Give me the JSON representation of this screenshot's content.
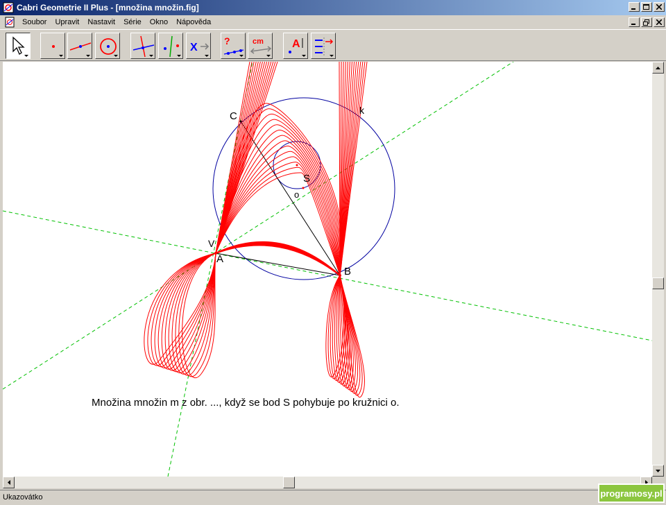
{
  "window": {
    "title": "Cabri Geometrie II Plus - [množina množin.fig]"
  },
  "menu": {
    "items": [
      {
        "label": "Soubor",
        "name": "menu-soubor"
      },
      {
        "label": "Upravit",
        "name": "menu-upravit"
      },
      {
        "label": "Nastavit",
        "name": "menu-nastavit"
      },
      {
        "label": "Série",
        "name": "menu-serie"
      },
      {
        "label": "Okno",
        "name": "menu-okno"
      },
      {
        "label": "Nápověda",
        "name": "menu-napoveda"
      }
    ]
  },
  "toolbar": {
    "tools": [
      {
        "icon": "pointer-icon",
        "name": "tool-pointer",
        "selected": true
      },
      {
        "icon": "point-icon",
        "name": "tool-point"
      },
      {
        "icon": "line-icon",
        "name": "tool-line"
      },
      {
        "icon": "circle-icon",
        "name": "tool-circle"
      },
      {
        "icon": "perpendicular-icon",
        "name": "tool-construct"
      },
      {
        "icon": "reflection-icon",
        "name": "tool-transform"
      },
      {
        "icon": "macro-icon",
        "name": "tool-macro"
      },
      {
        "icon": "check-property-icon",
        "name": "tool-check-property"
      },
      {
        "icon": "measure-icon",
        "name": "tool-measure"
      },
      {
        "icon": "text-label-icon",
        "name": "tool-display"
      },
      {
        "icon": "draw-attributes-icon",
        "name": "tool-draw"
      }
    ],
    "measure_unit": "cm"
  },
  "drawing": {
    "points": [
      {
        "label": "C",
        "color": "#000000"
      },
      {
        "label": "k",
        "color": "#0000a0"
      },
      {
        "label": "S",
        "color": "#0000a0"
      },
      {
        "label": "o",
        "color": "#0000a0"
      },
      {
        "label": "V",
        "color": "#ff0000"
      },
      {
        "label": "A",
        "color": "#000000"
      },
      {
        "label": "B",
        "color": "#000000"
      }
    ],
    "caption": "Množina množin m z obr. ..., když se bod S pohybuje po kružnici o.",
    "colors": {
      "locus": "#ff0000",
      "circle": "#0000a0",
      "auxiliary_line": "#00c000",
      "segment": "#000000"
    }
  },
  "status": {
    "text": "Ukazovátko"
  },
  "watermark": {
    "text": "programosy.pl"
  }
}
